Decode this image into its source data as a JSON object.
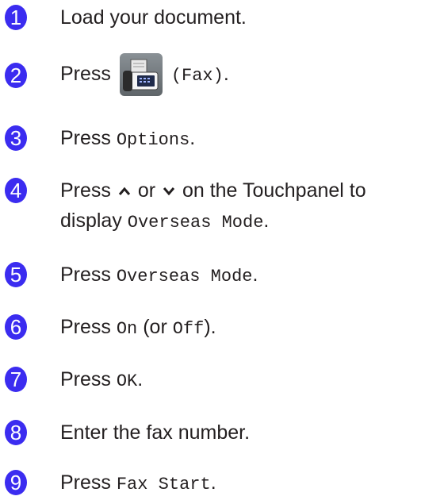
{
  "steps": [
    {
      "number": "1",
      "text": "Load your document."
    },
    {
      "number": "2",
      "press": "Press",
      "icon_label": "(Fax)",
      "icon": "fax-icon",
      "end": "."
    },
    {
      "number": "3",
      "press": "Press",
      "code": "Options",
      "end": "."
    },
    {
      "number": "4",
      "press": "Press",
      "or": "or",
      "line1_end": "on the Touchpanel to",
      "display": "display",
      "code": "Overseas Mode",
      "end": "."
    },
    {
      "number": "5",
      "press": "Press",
      "code": "Overseas Mode",
      "end": "."
    },
    {
      "number": "6",
      "press": "Press",
      "code": "On",
      "paren_or": "(or",
      "code2": "Off",
      "end": ")."
    },
    {
      "number": "7",
      "press": "Press",
      "code": "OK",
      "end": "."
    },
    {
      "number": "8",
      "text": "Enter the fax number."
    },
    {
      "number": "9",
      "press": "Press",
      "code": "Fax Start",
      "end": "."
    }
  ],
  "accent_color": "#3b2cf0",
  "icons": [
    "up-arrow-icon",
    "down-arrow-icon",
    "fax-icon"
  ]
}
